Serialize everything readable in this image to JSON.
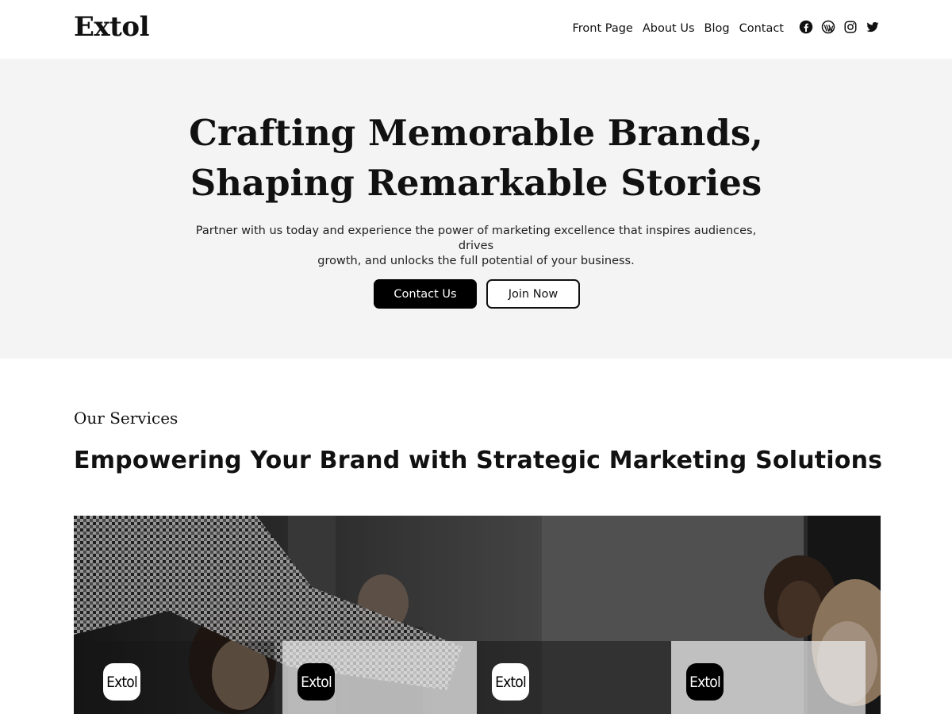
{
  "header": {
    "site_title": "Extol",
    "nav": [
      "Front Page",
      "About Us",
      "Blog",
      "Contact"
    ],
    "social_icons": [
      "facebook-icon",
      "wordpress-icon",
      "instagram-icon",
      "twitter-icon"
    ]
  },
  "hero": {
    "title_line1": "Crafting Memorable Brands,",
    "title_line2": "Shaping Remarkable Stories",
    "subtitle_line1": "Partner with us today and experience the power of marketing excellence that inspires audiences, drives",
    "subtitle_line2": "growth, and unlocks the full potential of your business.",
    "primary_button": "Contact Us",
    "secondary_button": "Join Now"
  },
  "services": {
    "eyebrow": "Our Services",
    "heading": "Empowering Your Brand with Strategic Marketing Solutions",
    "cards": [
      {
        "logo_text": "Extol",
        "badge": "light"
      },
      {
        "logo_text": "Extol",
        "badge": "dark"
      },
      {
        "logo_text": "Extol",
        "badge": "light"
      },
      {
        "logo_text": "Extol",
        "badge": "dark"
      }
    ]
  },
  "colors": {
    "hero_bg": "#f4f4f4",
    "primary_button_bg": "#000000",
    "text": "#111111"
  }
}
